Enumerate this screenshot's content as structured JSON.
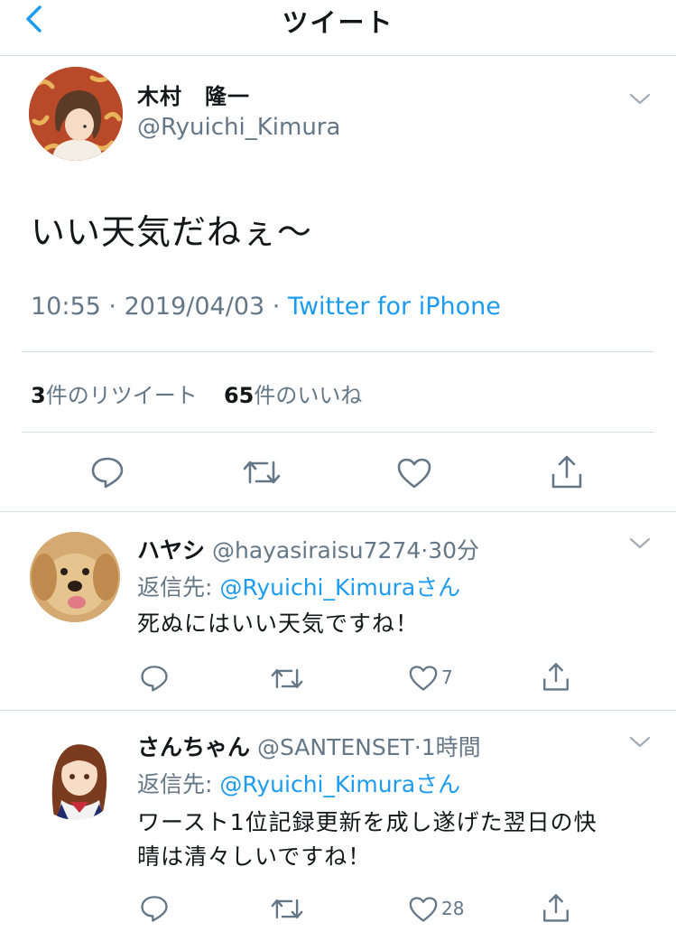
{
  "nav": {
    "title": "ツイート"
  },
  "tweet": {
    "display_name": "木村　隆一",
    "handle": "@Ryuichi_Kimura",
    "text": "いい天気だねぇ〜",
    "time": "10:55",
    "sep": " · ",
    "date": "2019/04/03",
    "source": "Twitter for iPhone",
    "retweet_count": "3",
    "retweet_label": "件のリツイート",
    "like_count": "65",
    "like_label": "件のいいね"
  },
  "replies": [
    {
      "display_name": "ハヤシ",
      "handle": "@hayasiraisu7274",
      "time": "30分",
      "reply_prefix": "返信先: ",
      "reply_to": "@Ryuichi_Kimura",
      "reply_suffix": "さん",
      "text_lines": [
        "死ぬにはいい天気ですね！"
      ],
      "like_count": "7"
    },
    {
      "display_name": "さんちゃん",
      "handle": "@SANTENSET",
      "time": "1時間",
      "reply_prefix": "返信先: ",
      "reply_to": "@Ryuichi_Kimura",
      "reply_suffix": "さん",
      "text_lines": [
        "ワースト1位記録更新を成し遂げた翌日の快",
        "晴は清々しいですね！"
      ],
      "like_count": "28"
    }
  ],
  "colors": {
    "accent": "#1d9bf0",
    "secondary": "#657786",
    "divider": "#d8dde1"
  }
}
